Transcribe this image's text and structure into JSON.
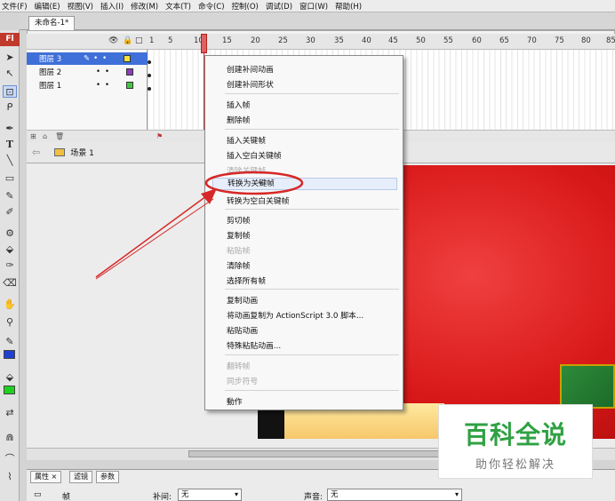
{
  "menubar": {
    "items": [
      "文件(F)",
      "编辑(E)",
      "视图(V)",
      "插入(I)",
      "修改(M)",
      "文本(T)",
      "命令(C)",
      "控制(O)",
      "调试(D)",
      "窗口(W)",
      "帮助(H)"
    ]
  },
  "doc_tab": "未命名-1*",
  "app_logo": "Fl",
  "timeline": {
    "ruler": [
      "1",
      "5",
      "10",
      "15",
      "20",
      "25",
      "30",
      "35",
      "40",
      "45",
      "50",
      "55",
      "60",
      "65",
      "70",
      "75",
      "80",
      "85"
    ],
    "layers": [
      {
        "name": "图层 3",
        "color": "#f3e23a",
        "selected": true
      },
      {
        "name": "图层 2",
        "color": "#8b3fb6",
        "selected": false
      },
      {
        "name": "图层 1",
        "color": "#45c545",
        "selected": false
      }
    ]
  },
  "editbar": {
    "scene": "场景 1"
  },
  "context_menu": {
    "groups": [
      [
        "创建补间动画",
        "创建补间形状"
      ],
      [
        "插入帧",
        "删除帧"
      ],
      [
        "插入关键帧",
        "插入空白关键帧",
        "清除关键帧",
        "转换为关键帧",
        "转换为空白关键帧"
      ],
      [
        "剪切帧",
        "复制帧",
        "粘贴帧",
        "清除帧",
        "选择所有帧"
      ],
      [
        "复制动画",
        "将动画复制为 ActionScript 3.0 脚本...",
        "粘贴动画",
        "特殊粘贴动画..."
      ],
      [
        "翻转帧",
        "同步符号"
      ],
      [
        "動作"
      ]
    ],
    "disabled": [
      "清除关键帧",
      "粘贴帧",
      "翻转帧",
      "同步符号"
    ],
    "highlighted": "转换为关键帧"
  },
  "properties": {
    "tabs": [
      "属性",
      "滤镜",
      "参数"
    ],
    "frame_label": "帧",
    "tween_label": "补间:",
    "tween_value": "无",
    "sound_label": "声音:",
    "sound_value": "无"
  },
  "watermark": {
    "title": "百科全说",
    "subtitle": "助你轻松解决"
  },
  "colors": {
    "accent_blue": "#3f6fd8",
    "annotation_red": "#d62828",
    "watermark_green": "#2fa143",
    "stage_red": "#d81818"
  },
  "swatches": {
    "stroke": "#1f3fd0",
    "fill": "#1fd01f"
  }
}
